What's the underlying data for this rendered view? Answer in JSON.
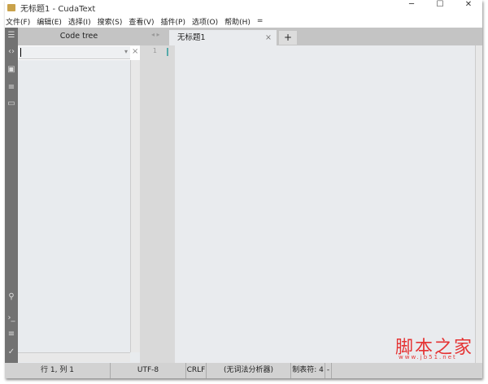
{
  "window": {
    "title": "无标题1 - CudaText",
    "minimize": "─",
    "maximize": "☐",
    "close": "✕"
  },
  "menu": [
    "文件(F)",
    "编辑(E)",
    "选择(I)",
    "搜索(S)",
    "查看(V)",
    "插件(P)",
    "选项(O)",
    "帮助(H)",
    "="
  ],
  "panel": {
    "title": "Code tree",
    "close": "×",
    "dropdown": "▾"
  },
  "tabs": {
    "arrows": "◂ ▸",
    "items": [
      {
        "label": "无标题1",
        "close": "×"
      }
    ],
    "add": "+"
  },
  "editor": {
    "line_number": "1"
  },
  "status": {
    "position": "行 1, 列 1",
    "encoding": "UTF-8",
    "line_ending": "CRLF",
    "lexer": "(无词法分析器)",
    "tab": "制表符: 4",
    "extra": "-"
  },
  "watermark": {
    "title": "脚本之家",
    "url": "www.jb51.net"
  }
}
